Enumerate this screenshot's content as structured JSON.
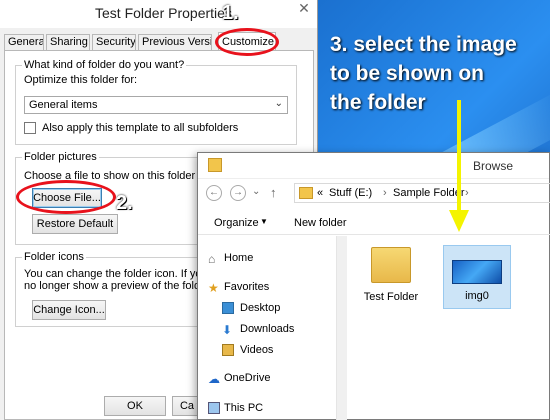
{
  "properties": {
    "title": "Test Folder Properties",
    "close_icon": "close-icon",
    "tabs": [
      {
        "label": "General"
      },
      {
        "label": "Sharing"
      },
      {
        "label": "Security"
      },
      {
        "label": "Previous Versions"
      },
      {
        "label": "Customize"
      }
    ],
    "kind_group": {
      "label": "What kind of folder do you want?",
      "optimize_label": "Optimize this folder for:",
      "optimize_value": "General items",
      "apply_label": "Also apply this template to all subfolders"
    },
    "pictures_group": {
      "label": "Folder pictures",
      "choose_text": "Choose a file to show on this folder icon.",
      "choose_button": "Choose File...",
      "restore_button": "Restore Default"
    },
    "icons_group": {
      "label": "Folder icons",
      "line1": "You can change the folder icon. If you ch",
      "line2": "no longer show a preview of the folder's c",
      "change_button": "Change Icon..."
    },
    "ok_button": "OK",
    "cancel_button": "Ca"
  },
  "annotations": {
    "step1": "1.",
    "step2": "2.",
    "step3_line1": "3. select the image",
    "step3_line2": "to be shown on",
    "step3_line3": "the folder",
    "accent": "#e8121c",
    "arrow_color": "#f4f400"
  },
  "browse": {
    "title": "Browse",
    "breadcrumb_prefix": "«",
    "breadcrumb": [
      "Stuff (E:)",
      "Sample Folder"
    ],
    "organize_label": "Organize",
    "new_folder_label": "New folder",
    "nav": [
      {
        "label": "Home",
        "icon": "home-icon"
      },
      {
        "label": "Favorites",
        "icon": "star-icon"
      },
      {
        "label": "Desktop",
        "icon": "desktop-icon"
      },
      {
        "label": "Downloads",
        "icon": "downloads-icon"
      },
      {
        "label": "Videos",
        "icon": "videos-icon"
      },
      {
        "label": "OneDrive",
        "icon": "onedrive-icon"
      },
      {
        "label": "This PC",
        "icon": "computer-icon"
      }
    ],
    "files": [
      {
        "label": "Test Folder",
        "icon": "folder-icon"
      },
      {
        "label": "img0",
        "icon": "image-thumbnail"
      }
    ]
  }
}
